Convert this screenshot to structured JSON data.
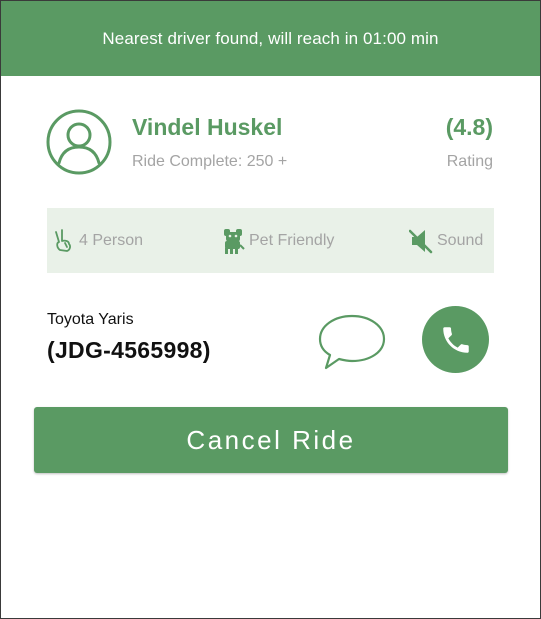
{
  "banner": {
    "text": "Nearest driver found, will reach in 01:00 min"
  },
  "driver": {
    "name": "Vindel Huskel",
    "rides_complete": "Ride Complete: 250 +",
    "rating_value": "(4.8)",
    "rating_label": "Rating",
    "avatar_icon": "user-circle-icon"
  },
  "features": [
    {
      "label": "4 Person",
      "icon": "hand-peace-icon"
    },
    {
      "label": "Pet Friendly",
      "icon": "dog-icon"
    },
    {
      "label": "Sound",
      "icon": "sound-muted-icon"
    }
  ],
  "vehicle": {
    "model": "Toyota Yaris",
    "plate": "(JDG-4565998)"
  },
  "actions": {
    "chat_icon": "chat-bubble-icon",
    "call_icon": "phone-icon",
    "cancel_label": "Cancel Ride"
  },
  "colors": {
    "primary": "#5a9a63",
    "feature_bg": "#e9f1e8",
    "muted_text": "#a4a4a4",
    "dark_text": "#111111"
  }
}
